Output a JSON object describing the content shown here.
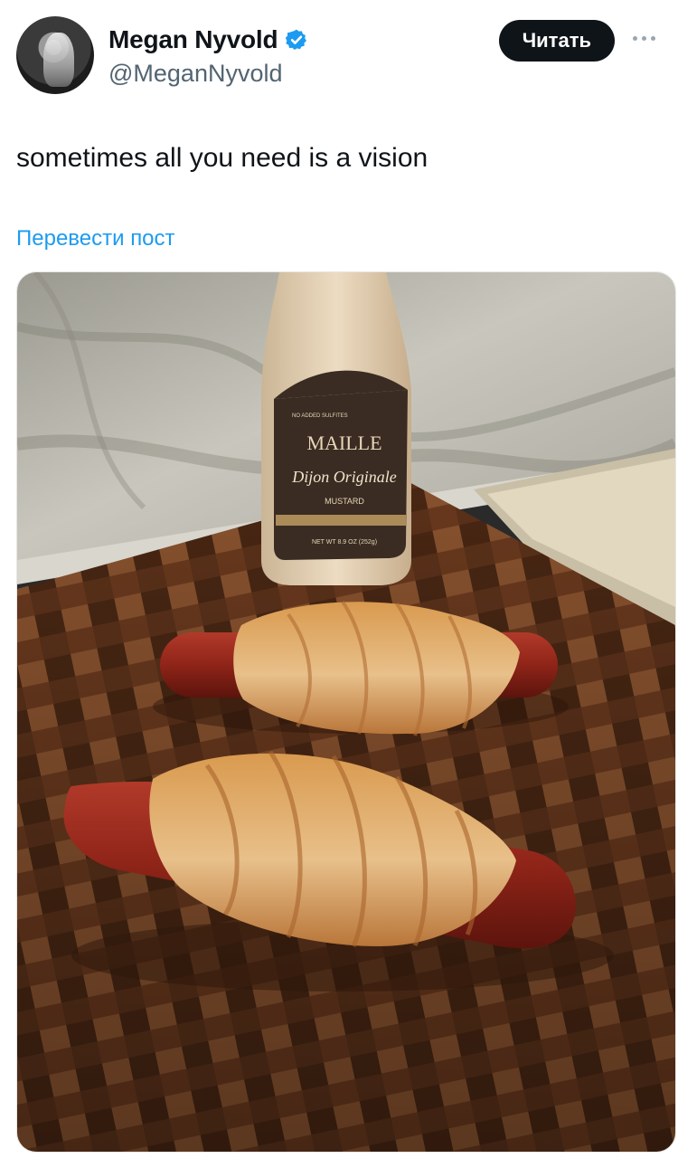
{
  "author": {
    "display_name": "Megan Nyvold",
    "handle": "@MeganNyvold"
  },
  "actions": {
    "follow_label": "Читать"
  },
  "tweet": {
    "text": "sometimes all you need is a vision",
    "translate_label": "Перевести пост"
  },
  "media": {
    "bottle_label": {
      "brand": "MAILLE",
      "product": "Dijon Originale",
      "type": "MUSTARD",
      "badge": "NO ADDED SULFITES",
      "net_wt": "NET WT 8.9 OZ (252g)"
    }
  },
  "colors": {
    "accent_link": "#1d9bf0",
    "verified": "#1d9bf0",
    "button_bg": "#0f1419"
  },
  "icons": [
    "verified-badge-icon",
    "more-options-icon"
  ]
}
